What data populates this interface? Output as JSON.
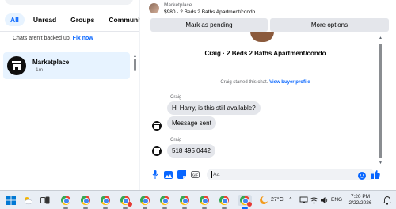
{
  "sidebar": {
    "filters": [
      "All",
      "Unread",
      "Groups",
      "Communities"
    ],
    "backup_notice": "Chats aren't backed up.",
    "backup_fix": "Fix now",
    "conversation": {
      "name": "Marketplace",
      "time": "· 1m"
    }
  },
  "header": {
    "title": "Marketplace",
    "subtitle": "$980 · 2 Beds 2 Baths Apartment/condo",
    "mark_pending": "Mark as pending",
    "more_options": "More options"
  },
  "chat": {
    "listing_title": "Craig · 2 Beds 2 Baths Apartment/condo",
    "started_text": "Craig started this chat.",
    "started_link": "View buyer profile",
    "messages": [
      {
        "sender": "Craig",
        "text": "Hi Harry, is this still available?"
      },
      {
        "sender": "",
        "text": "Message sent"
      },
      {
        "sender": "Craig",
        "text": "518 495 0442"
      }
    ]
  },
  "composer": {
    "placeholder": "Aa"
  },
  "taskbar": {
    "temperature": "27°C",
    "language": "ENG",
    "time": "7:20 PM",
    "date": "2/22/2026"
  },
  "colors": {
    "accent": "#0866ff",
    "bubble": "#e4e6eb",
    "selected": "#e7f3ff"
  }
}
